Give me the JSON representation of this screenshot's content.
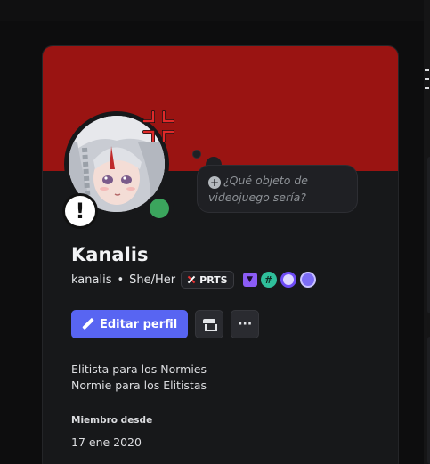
{
  "profile": {
    "display_name": "Kanalis",
    "username": "kanalis",
    "pronouns": "She/Her",
    "guild_tag": "PRTS",
    "thought_placeholder": "¿Qué objeto de videojuego sería?",
    "bio_lines": [
      "Elitista para los Normies",
      "Normie para los Elitistas"
    ],
    "member_since_label": "Miembro desde",
    "member_since_date": "17 ene 2020",
    "status": "online",
    "status_color": "#3ba55d",
    "banner_color": "#9a1412"
  },
  "actions": {
    "edit_label": "Editar perfil",
    "shop_icon": "shop-icon",
    "more_label": "···"
  },
  "badges": [
    "twitch-badge",
    "hashtag-badge",
    "gear-badge",
    "orb-badge"
  ],
  "colors": {
    "accent": "#5865f2",
    "card_bg": "#17181a"
  }
}
